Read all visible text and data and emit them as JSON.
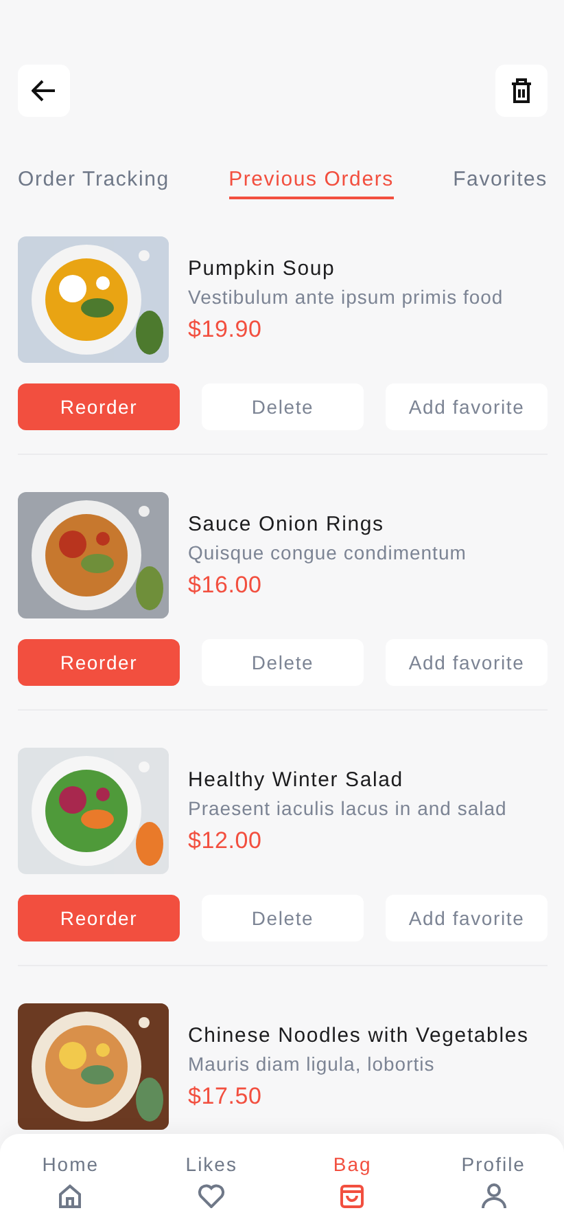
{
  "tabs": [
    {
      "label": "Order Tracking",
      "selected": false
    },
    {
      "label": "Previous Orders",
      "selected": true
    },
    {
      "label": "Favorites",
      "selected": false
    }
  ],
  "orders": [
    {
      "name": "Pumpkin Soup",
      "description": "Vestibulum ante ipsum primis food",
      "price": "$19.90",
      "buttons": [
        "Reorder",
        "Delete",
        "Add favorite"
      ]
    },
    {
      "name": "Sauce Onion Rings",
      "description": "Quisque congue condimentum",
      "price": "$16.00",
      "buttons": [
        "Reorder",
        "Delete",
        "Add favorite"
      ]
    },
    {
      "name": "Healthy Winter Salad",
      "description": "Praesent iaculis lacus in and salad",
      "price": "$12.00",
      "buttons": [
        "Reorder",
        "Delete",
        "Add favorite"
      ]
    },
    {
      "name": "Chinese Noodles with Vegetables",
      "description": "Mauris diam ligula, lobortis",
      "price": "$17.50"
    }
  ],
  "bottom_nav": [
    {
      "label": "Home",
      "selected": false
    },
    {
      "label": "Likes",
      "selected": false
    },
    {
      "label": "Bag",
      "selected": true
    },
    {
      "label": "Profile",
      "selected": false
    }
  ]
}
